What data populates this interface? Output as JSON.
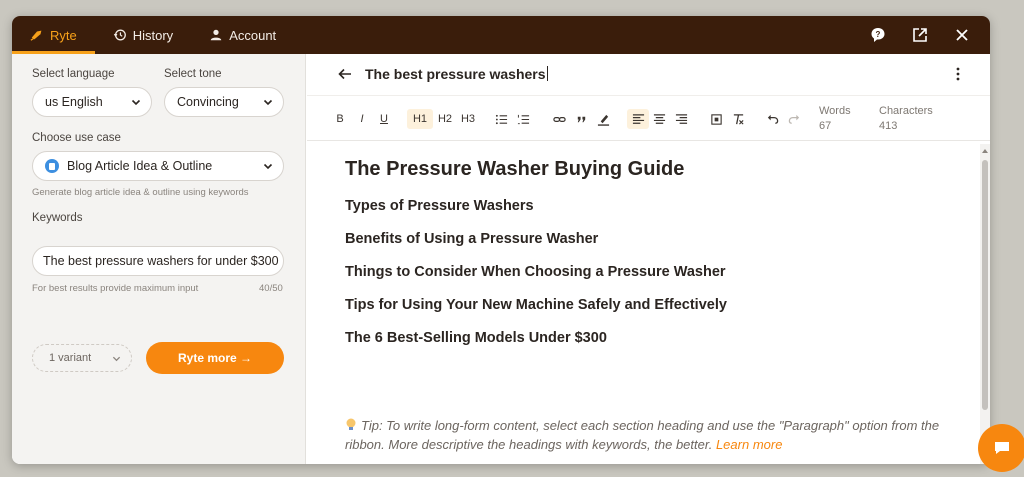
{
  "topbar": {
    "tabs": [
      {
        "label": "Ryte",
        "icon": "ryte-logo-icon",
        "active": true
      },
      {
        "label": "History",
        "icon": "history-icon",
        "active": false
      },
      {
        "label": "Account",
        "icon": "user-icon",
        "active": false
      }
    ],
    "icons": [
      "help-icon",
      "open-external-icon",
      "close-icon"
    ]
  },
  "left_panel": {
    "language_label": "Select language",
    "language_value": "us English",
    "tone_label": "Select tone",
    "tone_value": "Convincing",
    "use_case_label": "Choose use case",
    "use_case_value": "Blog Article Idea & Outline",
    "use_case_hint": "Generate blog article idea & outline using keywords",
    "keywords_label": "Keywords",
    "keywords_value": "The best pressure washers for under $300",
    "keywords_hint": "For best results provide maximum input",
    "keywords_count": "40/50",
    "variant_value": "1 variant",
    "ryte_more_label": "Ryte more →"
  },
  "editor": {
    "doc_title": "The best pressure washers",
    "toolbar": {
      "bold": "B",
      "italic": "I",
      "underline": "U",
      "h1": "H1",
      "h2": "H2",
      "h3": "H3",
      "words_label": "Words",
      "words_value": "67",
      "chars_label": "Characters",
      "chars_value": "413"
    },
    "heading": "The Pressure Washer Buying Guide",
    "sections": [
      "Types of Pressure Washers",
      "Benefits of Using a Pressure Washer",
      "Things to Consider When Choosing a Pressure Washer",
      "Tips for Using Your New Machine Safely and Effectively",
      "The 6 Best-Selling Models Under $300"
    ],
    "tip_text": "Tip: To write long-form content, select each section heading and use the \"Paragraph\" option from the ribbon. More descriptive the headings with keywords, the better.",
    "tip_link": "Learn more",
    "tip_arrow": "→"
  },
  "colors": {
    "topbar_bg": "#3a1d0b",
    "accent": "#f7870f",
    "active_tab": "#f7a11a"
  }
}
